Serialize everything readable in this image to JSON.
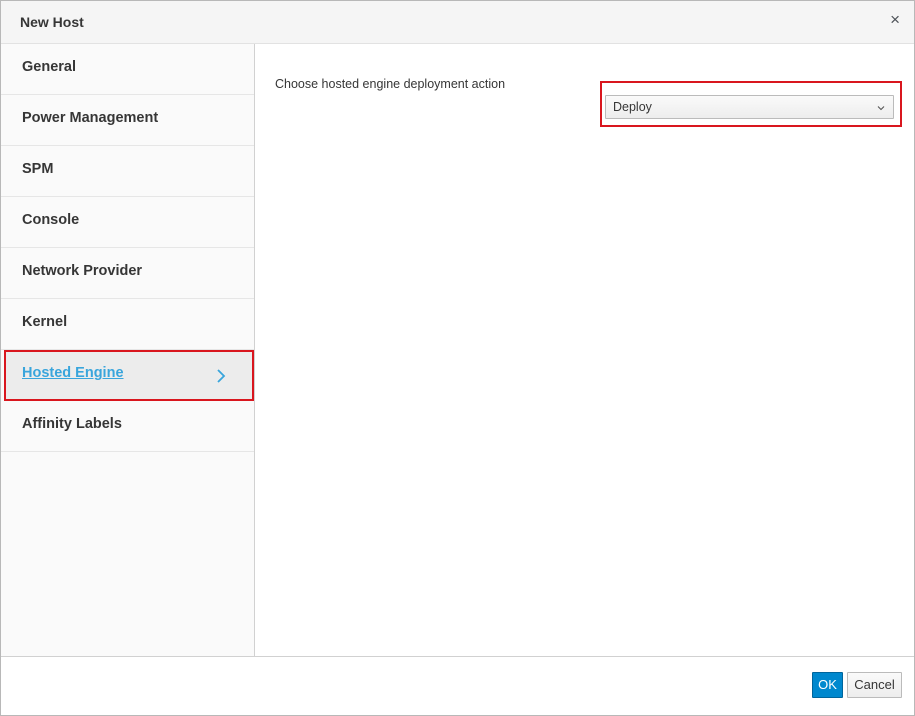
{
  "dialog": {
    "title": "New Host",
    "close_glyph": "×"
  },
  "sidebar": {
    "items": [
      {
        "label": "General",
        "active": false
      },
      {
        "label": "Power Management",
        "active": false
      },
      {
        "label": "SPM",
        "active": false
      },
      {
        "label": "Console",
        "active": false
      },
      {
        "label": "Network Provider",
        "active": false
      },
      {
        "label": "Kernel",
        "active": false
      },
      {
        "label": "Hosted Engine",
        "active": true
      },
      {
        "label": "Affinity Labels",
        "active": false
      }
    ]
  },
  "main": {
    "field_label": "Choose hosted engine deployment action",
    "select": {
      "value": "Deploy"
    }
  },
  "footer": {
    "ok_label": "OK",
    "cancel_label": "Cancel"
  },
  "colors": {
    "accent": "#0088ce",
    "active_link": "#39a5dc",
    "highlight": "#d9161e"
  },
  "icons": {
    "close": "close-icon",
    "active_item": "chevron-right-icon",
    "select": "chevron-down-icon"
  }
}
